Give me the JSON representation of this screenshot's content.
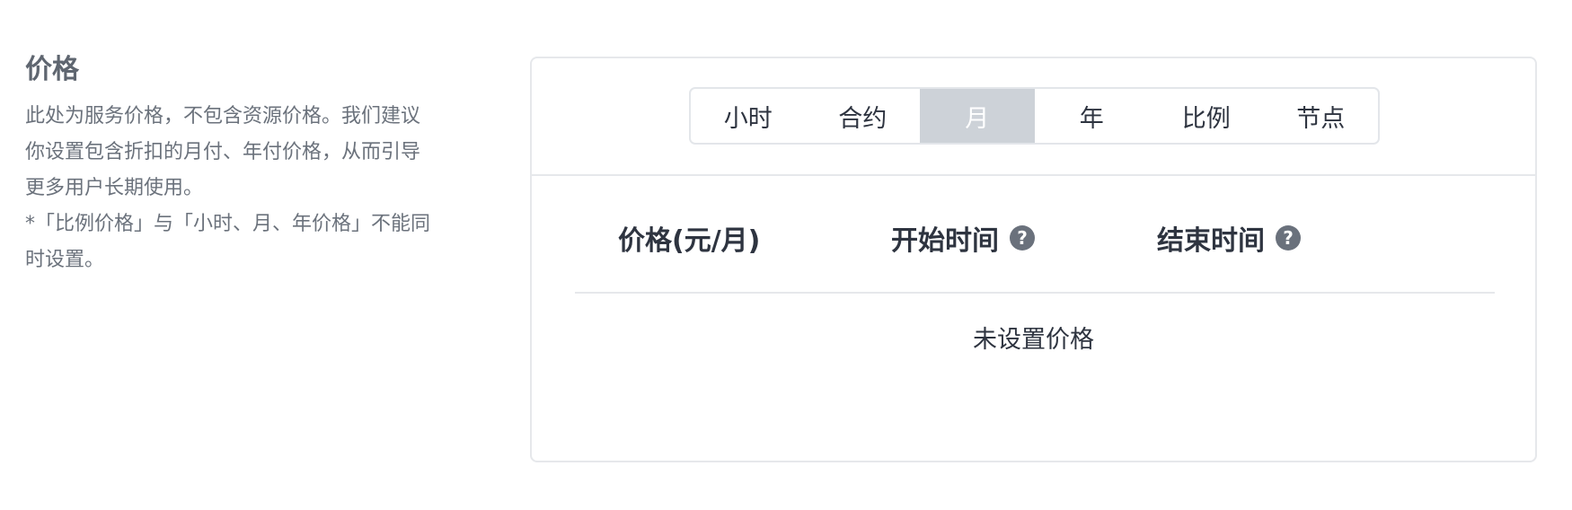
{
  "description": {
    "title": "价格",
    "line1": "此处为服务价格，不包含资源价格。我们建议",
    "line2": "你设置包含折扣的月付、年付价格，从而引导",
    "line3": "更多用户长期使用。",
    "line4": "*「比例价格」与「小时、月、年价格」不能同",
    "line5": "时设置。"
  },
  "tabs": {
    "items": [
      "小时",
      "合约",
      "月",
      "年",
      "比例",
      "节点"
    ],
    "active_index": 2
  },
  "table": {
    "col_price": "价格(元/月)",
    "col_start": "开始时间",
    "col_end": "结束时间",
    "help_glyph": "?",
    "empty_text": "未设置价格"
  },
  "colors": {
    "active_tab_bg": "#cdd2d8",
    "help_icon_bg": "#6a717c"
  }
}
